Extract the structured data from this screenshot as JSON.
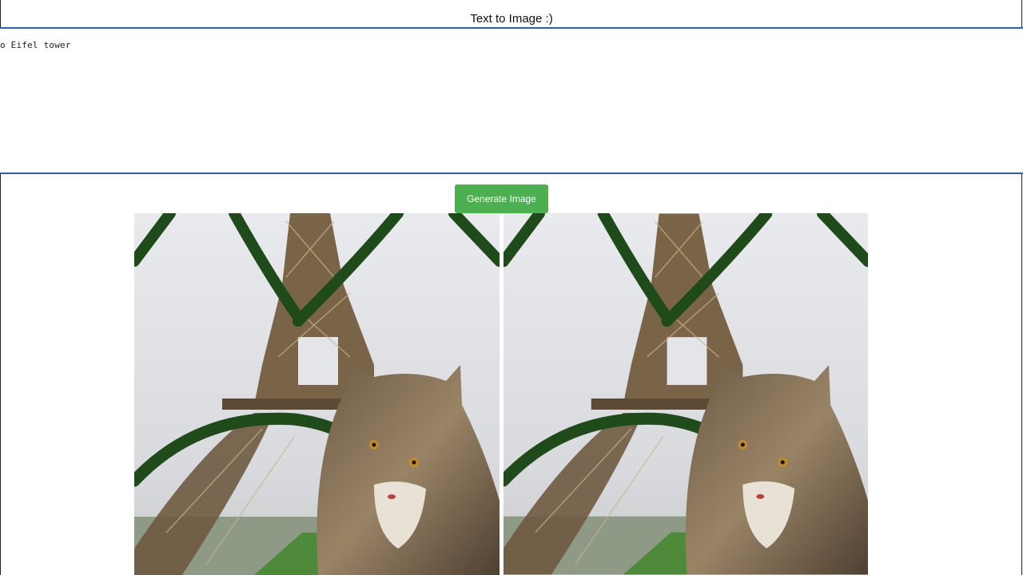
{
  "header": {
    "title": "Text to Image :)"
  },
  "prompt": {
    "visible_text": "o Eifel tower"
  },
  "generate_button": {
    "label": "Generate Image"
  },
  "results": [
    {
      "alt": "Generated image 1"
    },
    {
      "alt": "Generated image 2"
    }
  ],
  "colors": {
    "accent_blue": "#2a62b0",
    "button_green": "#4caf50",
    "vine_green": "#1f4a1a"
  }
}
